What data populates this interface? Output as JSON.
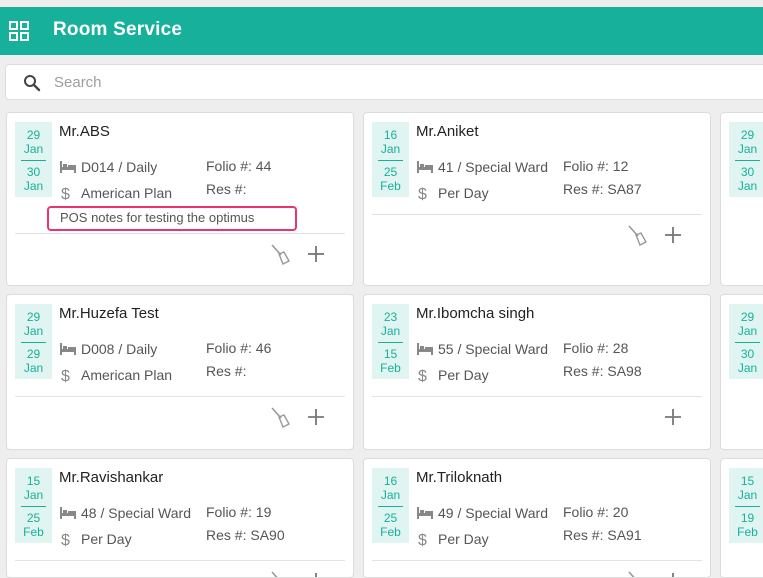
{
  "app": {
    "title": "Room Service"
  },
  "search": {
    "placeholder": "Search"
  },
  "cards": [
    {
      "guest": "Mr.ABS",
      "from_day": "29",
      "from_mon": "Jan",
      "to_day": "30",
      "to_mon": "Jan",
      "room": "D014 / Daily",
      "plan": "American Plan",
      "folio": "Folio #: 44",
      "res": "Res #:",
      "note": "POS notes for testing the optimus"
    },
    {
      "guest": "Mr.Aniket",
      "from_day": "16",
      "from_mon": "Jan",
      "to_day": "25",
      "to_mon": "Feb",
      "room": "41 / Special Ward",
      "plan": "Per Day",
      "folio": "Folio #: 12",
      "res": "Res #: SA87"
    },
    {
      "from_day": "29",
      "from_mon": "Jan",
      "to_day": "30",
      "to_mon": "Jan"
    },
    {
      "guest": "Mr.Huzefa Test",
      "from_day": "29",
      "from_mon": "Jan",
      "to_day": "29",
      "to_mon": "Jan",
      "room": "D008 / Daily",
      "plan": "American Plan",
      "folio": "Folio #: 46",
      "res": "Res #:"
    },
    {
      "guest": "Mr.Ibomcha singh",
      "from_day": "23",
      "from_mon": "Jan",
      "to_day": "15",
      "to_mon": "Feb",
      "room": "55 / Special Ward",
      "plan": "Per Day",
      "folio": "Folio #: 28",
      "res": "Res #: SA98"
    },
    {
      "from_day": "29",
      "from_mon": "Jan",
      "to_day": "30",
      "to_mon": "Jan"
    },
    {
      "guest": "Mr.Ravishankar",
      "from_day": "15",
      "from_mon": "Jan",
      "to_day": "25",
      "to_mon": "Feb",
      "room": "48 / Special Ward",
      "plan": "Per Day",
      "folio": "Folio #: 19",
      "res": "Res #: SA90"
    },
    {
      "guest": "Mr.Triloknath",
      "from_day": "16",
      "from_mon": "Jan",
      "to_day": "25",
      "to_mon": "Feb",
      "room": "49 / Special Ward",
      "plan": "Per Day",
      "folio": "Folio #: 20",
      "res": "Res #: SA91"
    },
    {
      "from_day": "15",
      "from_mon": "Jan",
      "to_day": "19",
      "to_mon": "Feb"
    }
  ],
  "icons": {
    "grid": "grid-icon",
    "search": "search-icon",
    "bed": "bed-icon",
    "dollar": "dollar-icon",
    "broom": "broom-icon",
    "add": "plus-icon"
  },
  "colors": {
    "accent": "#17b09a",
    "note_highlight": "#e8356b"
  }
}
